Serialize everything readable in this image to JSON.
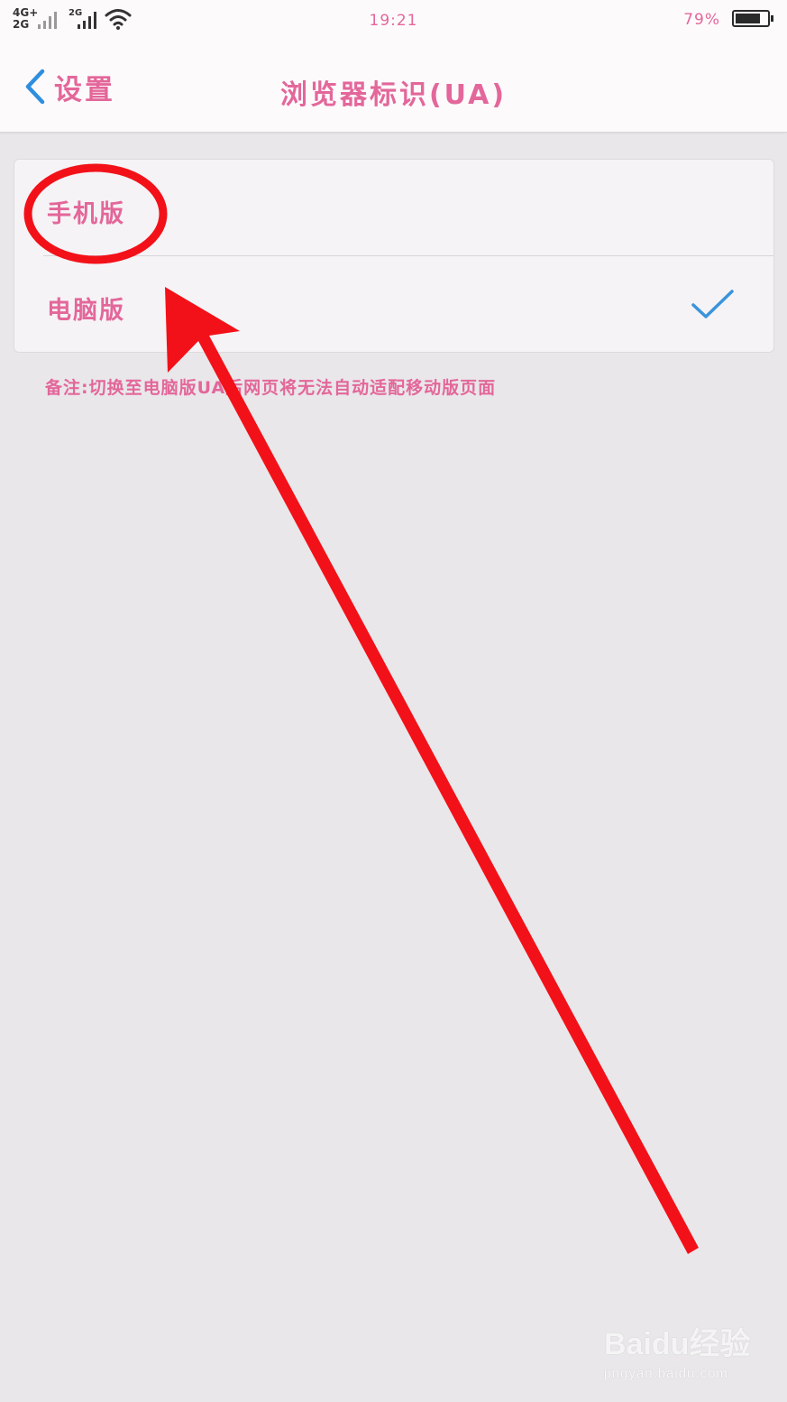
{
  "status_bar": {
    "network_primary": "4G+",
    "network_secondary": "2G",
    "network_sim2": "2G",
    "wifi_icon": "wifi-icon",
    "time": "19:21",
    "battery_percent": "79%",
    "battery_level": 0.79
  },
  "header": {
    "back_icon": "chevron-left-icon",
    "back_label": "设置",
    "title": "浏览器标识(UA)"
  },
  "options": [
    {
      "label": "手机版",
      "selected": false
    },
    {
      "label": "电脑版",
      "selected": true,
      "check_icon": "checkmark-icon"
    }
  ],
  "footnote": "备注:切换至电脑版UA后网页将无法自动适配移动版页面",
  "colors": {
    "accent_text": "#e3679a",
    "back_chevron": "#2f8fde",
    "checkmark": "#3a94dc",
    "annotation_red": "#f31119",
    "background": "#e9e7ea",
    "card": "#f5f3f6"
  },
  "watermark": {
    "brand": "Baidu经验",
    "sub": "jingyan.baidu.com"
  }
}
